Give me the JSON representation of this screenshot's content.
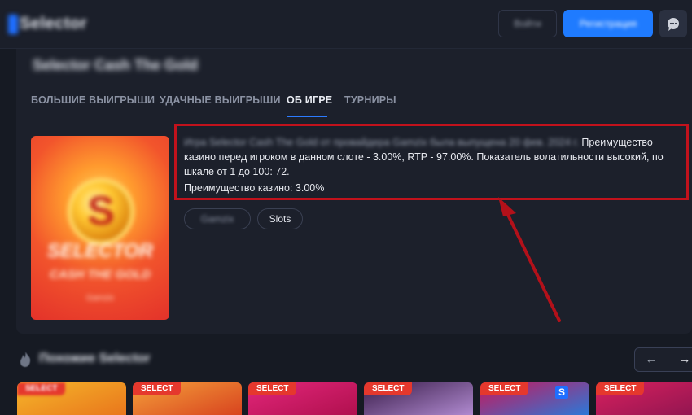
{
  "header": {
    "logo": "Selector",
    "login_label": "Войти",
    "register_label": "Регистрация",
    "chat_icon": "chat-bubble-icon"
  },
  "game": {
    "title": "Selector Cash The Gold",
    "tabs": [
      {
        "label": "БОЛЬШИЕ ВЫИГРЫШИ",
        "active": false
      },
      {
        "label": "УДАЧНЫЕ ВЫИГРЫШИ",
        "active": false
      },
      {
        "label": "ОБ ИГРЕ",
        "active": true
      },
      {
        "label": "ТУРНИРЫ",
        "active": false
      }
    ],
    "cover": {
      "letter": "S",
      "line1": "SELECTOR",
      "line2": "CASH THE GOLD",
      "line3": "Gamzix"
    },
    "description_blurred": "Игра Selector Cash The Gold от провайдера Gamzix была выпущена 20 фев. 2024 г.",
    "description": "Преимущество казино перед игроком в данном слоте - 3.00%, RTP - 97.00%. Показатель волатильности высокий, по шкале от 1 до 100: 72.",
    "house_edge": "Преимущество казино: 3.00%",
    "chips": [
      "Gamzix",
      "Slots"
    ]
  },
  "similar": {
    "title": "Похожие Selector",
    "fire_icon": "fire-icon",
    "prev_icon": "arrow-left-icon",
    "next_icon": "arrow-right-icon",
    "prev_glyph": "←",
    "next_glyph": "→",
    "thumbs": [
      {
        "tag": "SELECT",
        "colors": [
          "#f5b62a",
          "#e9761c"
        ]
      },
      {
        "tag": "SELECT",
        "colors": [
          "#f4a03a",
          "#d8431f"
        ]
      },
      {
        "tag": "SELECT",
        "colors": [
          "#e2267a",
          "#b0104e"
        ]
      },
      {
        "tag": "SELECT",
        "colors": [
          "#3a1d4a",
          "#b08ad0"
        ]
      },
      {
        "tag": "SELECT",
        "colors": [
          "#c8175a",
          "#2b78d8"
        ],
        "badge": "S"
      },
      {
        "tag": "SELECT",
        "colors": [
          "#d8205e",
          "#8e1550"
        ]
      }
    ]
  },
  "colors": {
    "accent_blue": "#1f7bff",
    "highlight_red": "#c1121c",
    "background": "#161a23",
    "panel": "#1c202b"
  }
}
